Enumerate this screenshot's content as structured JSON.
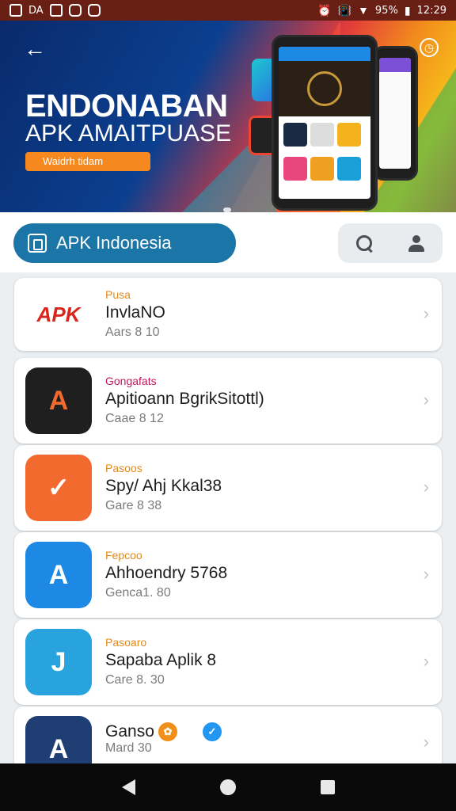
{
  "status_bar": {
    "left_icons": [
      "image-icon",
      "app-icon",
      "square-icon",
      "square-icon",
      "chat-icon",
      "photo-icon"
    ],
    "left_text": "DA",
    "battery_pct": "95%",
    "time": "12:29"
  },
  "banner": {
    "title": "ENDONABAN",
    "subtitle": "APK AMAITPUASE",
    "pill_label": "Waidrh tidam",
    "back_icon": "arrow-left-icon",
    "info_icon": "clock-icon",
    "colors": {
      "navy": "#0b3f8f",
      "orange": "#f5891f",
      "red": "#e23b3b",
      "yellow": "#f7c21a"
    }
  },
  "search_row": {
    "brand_label": "APK Indonesia",
    "brand_color": "#1b75a6",
    "search_icon": "search-icon",
    "profile_icon": "user-icon"
  },
  "apps": [
    {
      "category": "Pusa",
      "name": "InvlaNO",
      "meta": "Aars 8 10",
      "icon_text": "APK",
      "icon_color": "#ffffff",
      "category_color": "#e08a1a"
    },
    {
      "category": "Gongafats",
      "name": "Apitioann BgrikSitottl)",
      "meta": "Caae 8 12",
      "icon_text": "A",
      "icon_color": "#1f1f1f",
      "category_color": "#c2185b"
    },
    {
      "category": "Pasoos",
      "name": "Spy/ Ahj Kkal38",
      "meta": "Gare 8 38",
      "icon_text": "✓",
      "icon_color": "#f26a2e",
      "category_color": "#e08a1a"
    },
    {
      "category": "Fepcoo",
      "name": "Ahhoendry 5768",
      "meta": "Genca1. 80",
      "icon_text": "A",
      "icon_color": "#1e88e5",
      "category_color": "#e08a1a"
    },
    {
      "category": "Pasoaro",
      "name": "Sapaba Aplik 8",
      "meta": "Care 8. 30",
      "icon_text": "J",
      "icon_color": "#29a3dd",
      "category_color": "#e08a1a"
    },
    {
      "category": "",
      "name": "Ganso",
      "meta": "Mard 30",
      "icon_text": "A",
      "icon_color": "#1f3e73",
      "category_color": "#e08a1a"
    }
  ],
  "nav_bar": {
    "back_icon": "back-triangle-icon",
    "home_icon": "home-circle-icon",
    "recent_icon": "recent-square-icon"
  }
}
